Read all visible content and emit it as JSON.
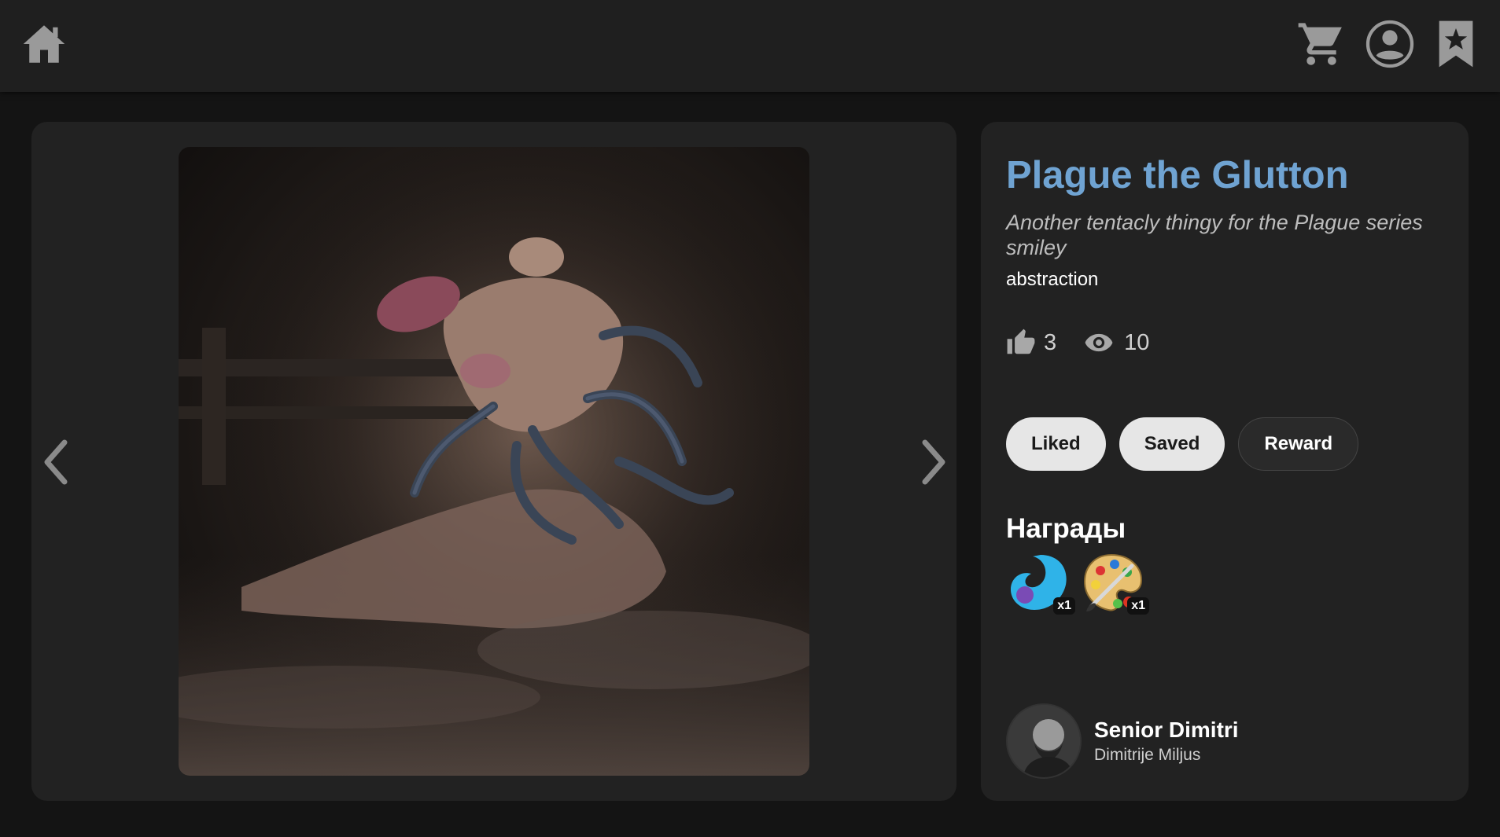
{
  "header": {
    "icons": [
      "home-icon",
      "cart-icon",
      "profile-icon",
      "bookmark-star-icon"
    ],
    "icon_color": "#9a9a9a"
  },
  "viewer": {
    "prev_icon": "chevron-left-icon",
    "next_icon": "chevron-right-icon"
  },
  "post": {
    "title": "Plague the Glutton",
    "description": "Another tentacly thingy for the Plague series smiley",
    "tag": "abstraction",
    "likes": "3",
    "views": "10",
    "title_color": "#6fa3d2"
  },
  "actions": {
    "liked_label": "Liked",
    "saved_label": "Saved",
    "reward_label": "Reward"
  },
  "rewards": {
    "heading": "Награды",
    "items": [
      {
        "icon": "blue-swirl-badge-icon",
        "count": "x1"
      },
      {
        "icon": "palette-badge-icon",
        "count": "x1"
      }
    ]
  },
  "author": {
    "name": "Senior Dimitri",
    "handle": "Dimitrije Miljus"
  }
}
